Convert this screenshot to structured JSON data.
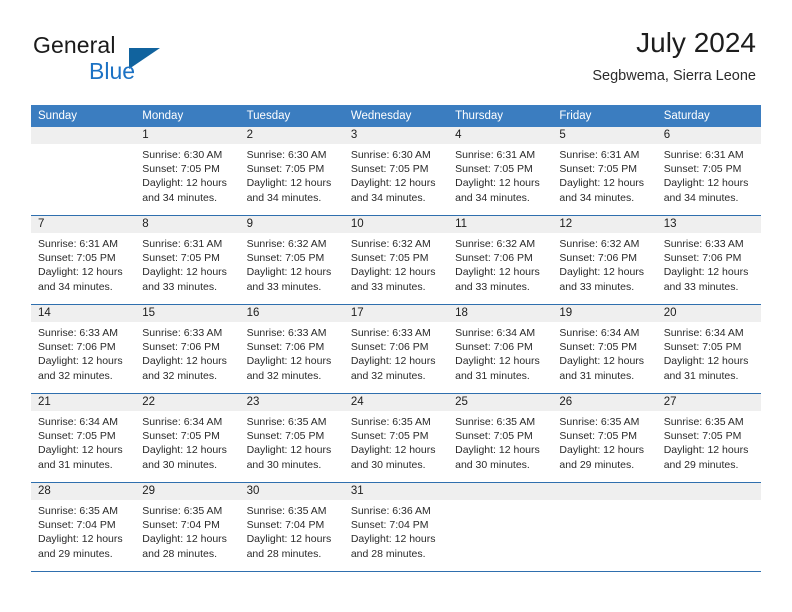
{
  "brand": {
    "name_top": "General",
    "name_bottom": "Blue",
    "accent_color": "#11639e",
    "text_color": "#1c72c4"
  },
  "header": {
    "title": "July 2024",
    "subtitle": "Segbwema, Sierra Leone"
  },
  "theme": {
    "header_row_bg": "#3b7dc0",
    "daynum_row_bg": "#efefef",
    "week_divider": "#2f6fae"
  },
  "weekdays": [
    "Sunday",
    "Monday",
    "Tuesday",
    "Wednesday",
    "Thursday",
    "Friday",
    "Saturday"
  ],
  "weeks": [
    {
      "days": [
        {
          "num": "",
          "l1": "",
          "l2": "",
          "l3": "",
          "l4": "",
          "empty": true
        },
        {
          "num": "1",
          "l1": "Sunrise: 6:30 AM",
          "l2": "Sunset: 7:05 PM",
          "l3": "Daylight: 12 hours",
          "l4": "and 34 minutes.",
          "empty": false
        },
        {
          "num": "2",
          "l1": "Sunrise: 6:30 AM",
          "l2": "Sunset: 7:05 PM",
          "l3": "Daylight: 12 hours",
          "l4": "and 34 minutes.",
          "empty": false
        },
        {
          "num": "3",
          "l1": "Sunrise: 6:30 AM",
          "l2": "Sunset: 7:05 PM",
          "l3": "Daylight: 12 hours",
          "l4": "and 34 minutes.",
          "empty": false
        },
        {
          "num": "4",
          "l1": "Sunrise: 6:31 AM",
          "l2": "Sunset: 7:05 PM",
          "l3": "Daylight: 12 hours",
          "l4": "and 34 minutes.",
          "empty": false
        },
        {
          "num": "5",
          "l1": "Sunrise: 6:31 AM",
          "l2": "Sunset: 7:05 PM",
          "l3": "Daylight: 12 hours",
          "l4": "and 34 minutes.",
          "empty": false
        },
        {
          "num": "6",
          "l1": "Sunrise: 6:31 AM",
          "l2": "Sunset: 7:05 PM",
          "l3": "Daylight: 12 hours",
          "l4": "and 34 minutes.",
          "empty": false
        }
      ]
    },
    {
      "days": [
        {
          "num": "7",
          "l1": "Sunrise: 6:31 AM",
          "l2": "Sunset: 7:05 PM",
          "l3": "Daylight: 12 hours",
          "l4": "and 34 minutes.",
          "empty": false
        },
        {
          "num": "8",
          "l1": "Sunrise: 6:31 AM",
          "l2": "Sunset: 7:05 PM",
          "l3": "Daylight: 12 hours",
          "l4": "and 33 minutes.",
          "empty": false
        },
        {
          "num": "9",
          "l1": "Sunrise: 6:32 AM",
          "l2": "Sunset: 7:05 PM",
          "l3": "Daylight: 12 hours",
          "l4": "and 33 minutes.",
          "empty": false
        },
        {
          "num": "10",
          "l1": "Sunrise: 6:32 AM",
          "l2": "Sunset: 7:05 PM",
          "l3": "Daylight: 12 hours",
          "l4": "and 33 minutes.",
          "empty": false
        },
        {
          "num": "11",
          "l1": "Sunrise: 6:32 AM",
          "l2": "Sunset: 7:06 PM",
          "l3": "Daylight: 12 hours",
          "l4": "and 33 minutes.",
          "empty": false
        },
        {
          "num": "12",
          "l1": "Sunrise: 6:32 AM",
          "l2": "Sunset: 7:06 PM",
          "l3": "Daylight: 12 hours",
          "l4": "and 33 minutes.",
          "empty": false
        },
        {
          "num": "13",
          "l1": "Sunrise: 6:33 AM",
          "l2": "Sunset: 7:06 PM",
          "l3": "Daylight: 12 hours",
          "l4": "and 33 minutes.",
          "empty": false
        }
      ]
    },
    {
      "days": [
        {
          "num": "14",
          "l1": "Sunrise: 6:33 AM",
          "l2": "Sunset: 7:06 PM",
          "l3": "Daylight: 12 hours",
          "l4": "and 32 minutes.",
          "empty": false
        },
        {
          "num": "15",
          "l1": "Sunrise: 6:33 AM",
          "l2": "Sunset: 7:06 PM",
          "l3": "Daylight: 12 hours",
          "l4": "and 32 minutes.",
          "empty": false
        },
        {
          "num": "16",
          "l1": "Sunrise: 6:33 AM",
          "l2": "Sunset: 7:06 PM",
          "l3": "Daylight: 12 hours",
          "l4": "and 32 minutes.",
          "empty": false
        },
        {
          "num": "17",
          "l1": "Sunrise: 6:33 AM",
          "l2": "Sunset: 7:06 PM",
          "l3": "Daylight: 12 hours",
          "l4": "and 32 minutes.",
          "empty": false
        },
        {
          "num": "18",
          "l1": "Sunrise: 6:34 AM",
          "l2": "Sunset: 7:06 PM",
          "l3": "Daylight: 12 hours",
          "l4": "and 31 minutes.",
          "empty": false
        },
        {
          "num": "19",
          "l1": "Sunrise: 6:34 AM",
          "l2": "Sunset: 7:05 PM",
          "l3": "Daylight: 12 hours",
          "l4": "and 31 minutes.",
          "empty": false
        },
        {
          "num": "20",
          "l1": "Sunrise: 6:34 AM",
          "l2": "Sunset: 7:05 PM",
          "l3": "Daylight: 12 hours",
          "l4": "and 31 minutes.",
          "empty": false
        }
      ]
    },
    {
      "days": [
        {
          "num": "21",
          "l1": "Sunrise: 6:34 AM",
          "l2": "Sunset: 7:05 PM",
          "l3": "Daylight: 12 hours",
          "l4": "and 31 minutes.",
          "empty": false
        },
        {
          "num": "22",
          "l1": "Sunrise: 6:34 AM",
          "l2": "Sunset: 7:05 PM",
          "l3": "Daylight: 12 hours",
          "l4": "and 30 minutes.",
          "empty": false
        },
        {
          "num": "23",
          "l1": "Sunrise: 6:35 AM",
          "l2": "Sunset: 7:05 PM",
          "l3": "Daylight: 12 hours",
          "l4": "and 30 minutes.",
          "empty": false
        },
        {
          "num": "24",
          "l1": "Sunrise: 6:35 AM",
          "l2": "Sunset: 7:05 PM",
          "l3": "Daylight: 12 hours",
          "l4": "and 30 minutes.",
          "empty": false
        },
        {
          "num": "25",
          "l1": "Sunrise: 6:35 AM",
          "l2": "Sunset: 7:05 PM",
          "l3": "Daylight: 12 hours",
          "l4": "and 30 minutes.",
          "empty": false
        },
        {
          "num": "26",
          "l1": "Sunrise: 6:35 AM",
          "l2": "Sunset: 7:05 PM",
          "l3": "Daylight: 12 hours",
          "l4": "and 29 minutes.",
          "empty": false
        },
        {
          "num": "27",
          "l1": "Sunrise: 6:35 AM",
          "l2": "Sunset: 7:05 PM",
          "l3": "Daylight: 12 hours",
          "l4": "and 29 minutes.",
          "empty": false
        }
      ]
    },
    {
      "days": [
        {
          "num": "28",
          "l1": "Sunrise: 6:35 AM",
          "l2": "Sunset: 7:04 PM",
          "l3": "Daylight: 12 hours",
          "l4": "and 29 minutes.",
          "empty": false
        },
        {
          "num": "29",
          "l1": "Sunrise: 6:35 AM",
          "l2": "Sunset: 7:04 PM",
          "l3": "Daylight: 12 hours",
          "l4": "and 28 minutes.",
          "empty": false
        },
        {
          "num": "30",
          "l1": "Sunrise: 6:35 AM",
          "l2": "Sunset: 7:04 PM",
          "l3": "Daylight: 12 hours",
          "l4": "and 28 minutes.",
          "empty": false
        },
        {
          "num": "31",
          "l1": "Sunrise: 6:36 AM",
          "l2": "Sunset: 7:04 PM",
          "l3": "Daylight: 12 hours",
          "l4": "and 28 minutes.",
          "empty": false
        },
        {
          "num": "",
          "l1": "",
          "l2": "",
          "l3": "",
          "l4": "",
          "empty": true
        },
        {
          "num": "",
          "l1": "",
          "l2": "",
          "l3": "",
          "l4": "",
          "empty": true
        },
        {
          "num": "",
          "l1": "",
          "l2": "",
          "l3": "",
          "l4": "",
          "empty": true
        }
      ]
    }
  ]
}
